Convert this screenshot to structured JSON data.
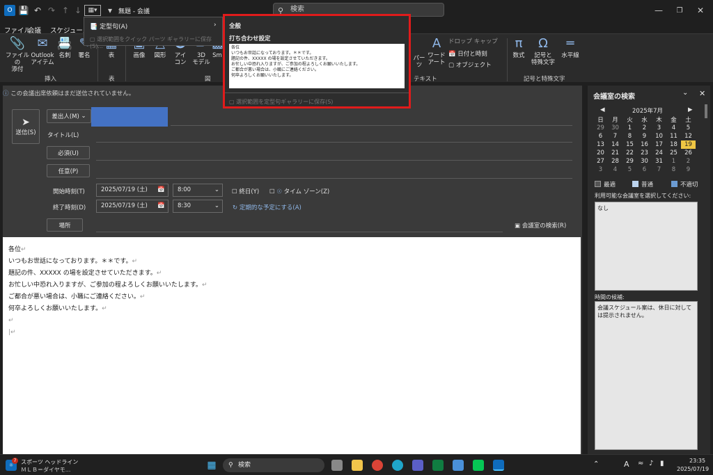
{
  "window": {
    "title": "無題 - 会議"
  },
  "titlebar": {
    "search_placeholder": "検索"
  },
  "menu_tabs": [
    "ファイル",
    "会議",
    "スケジュール"
  ],
  "ribbon": {
    "buttons": [
      {
        "label1": "ファイルの",
        "label2": "添付"
      },
      {
        "label1": "Outlook",
        "label2": "アイテム"
      },
      {
        "label1": "名刺",
        "label2": ""
      },
      {
        "label1": "署名",
        "label2": ""
      },
      {
        "label1": "表",
        "label2": ""
      },
      {
        "label1": "画像",
        "label2": ""
      },
      {
        "label1": "図形",
        "label2": ""
      },
      {
        "label1": "アイ",
        "label2": "コン"
      },
      {
        "label1": "3D",
        "label2": "モデル"
      },
      {
        "label1": "Sm",
        "label2": ""
      },
      {
        "label1": "パーツ",
        "label2": ""
      },
      {
        "label1": "ワード",
        "label2": "アート"
      },
      {
        "label1": "数式",
        "label2": ""
      },
      {
        "label1": "記号と",
        "label2": "特殊文字"
      },
      {
        "label1": "水平線",
        "label2": ""
      }
    ],
    "small_buttons": [
      "ドロップ キャップ",
      "日付と時刻",
      "オブジェクト"
    ],
    "groups": [
      "挿入",
      "表",
      "図",
      "テキスト",
      "記号と特殊文字"
    ]
  },
  "dropdown": {
    "item1": "定型句(A)",
    "item2": "選択範囲をクイック パーツ ギャラリーに保存(S)..."
  },
  "popup": {
    "section": "全般",
    "entry_title": "打ち合わせ設定",
    "preview_lines": [
      "各位",
      "いつもお世話になっております。＊＊です。",
      "題記の件、XXXXX の場を設定させていただきます。",
      "お忙しい中恐れ入りますが、ご参加の程よろしくお願いいたします。",
      "ご都合が悪い場合は、小職にご連絡ください。",
      "何卒よろしくお願いいたします。"
    ],
    "save_label": "選択範囲を定型句ギャラリーに保存(S)"
  },
  "compose": {
    "info_text": "この会議出席依頼はまだ送信されていません。",
    "send_label": "送信(S)",
    "from_label": "差出人(M)",
    "title_label": "タイトル(L)",
    "required_label": "必須(U)",
    "optional_label": "任意(P)",
    "start_label": "開始時刻(T)",
    "end_label": "終了時刻(D)",
    "start_date": "2025/07/19 (土)",
    "start_time": "8:00",
    "end_date": "2025/07/19 (土)",
    "end_time": "8:30",
    "allday_label": "終日(Y)",
    "timezone_label": "タイム ゾーン(Z)",
    "recurring_label": "定期的な予定にする(A)",
    "location_label": "場所",
    "room_finder_label": "会議室の検索(R)",
    "body_lines": [
      "各位",
      "いつもお世話になっております。＊＊です。",
      "題記の件、XXXXX の場を設定させていただきます。",
      "お忙しい中恐れ入りますが、ご参加の程よろしくお願いいたします。",
      "ご都合が悪い場合は、小職にご連絡ください。",
      "何卒よろしくお願いいたします。"
    ]
  },
  "room_pane": {
    "title": "会議室の検索",
    "month": "2025年7月",
    "weekdays": [
      "日",
      "月",
      "火",
      "水",
      "木",
      "金",
      "土"
    ],
    "weeks": [
      [
        "29",
        "30",
        "1",
        "2",
        "3",
        "4",
        "5"
      ],
      [
        "6",
        "7",
        "8",
        "9",
        "10",
        "11",
        "12"
      ],
      [
        "13",
        "14",
        "15",
        "16",
        "17",
        "18",
        "19"
      ],
      [
        "20",
        "21",
        "22",
        "23",
        "24",
        "25",
        "26"
      ],
      [
        "27",
        "28",
        "29",
        "30",
        "31",
        "1",
        "2"
      ],
      [
        "3",
        "4",
        "5",
        "6",
        "7",
        "8",
        "9"
      ]
    ],
    "selected_day": "19",
    "legend": [
      "最適",
      "普通",
      "不適切"
    ],
    "room_prompt": "利用可能な会議室を選択してください:",
    "room_value": "なし",
    "time_label": "時間の候補:",
    "time_text": "会議スケジュール案は、休日に対しては提示されません。"
  },
  "taskbar": {
    "news_title": "スポーツ ヘッドライン",
    "news_sub": "ＭＬＢ＝ダイヤモ...",
    "news_badge": "7",
    "search_label": "検索",
    "time": "23:35",
    "date": "2025/07/19"
  },
  "colors": {
    "accent": "#4472c4",
    "highlight_border": "#e01b1b",
    "selected_day": "#efc643"
  }
}
